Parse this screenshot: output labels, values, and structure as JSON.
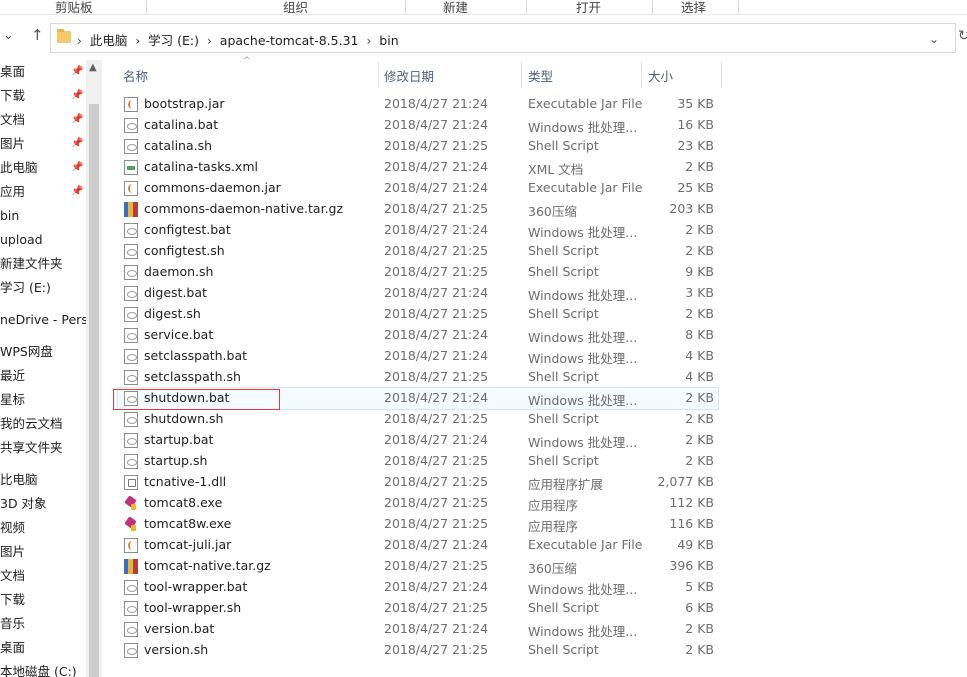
{
  "ribbon": {
    "groups": [
      "剪贴板",
      "组织",
      "新建",
      "打开",
      "选择"
    ]
  },
  "nav_buttons": {
    "dropdown_glyph": "⌄",
    "up_glyph": "↑"
  },
  "address": {
    "breadcrumbs": [
      "此电脑",
      "学习 (E:)",
      "apache-tomcat-8.5.31",
      "bin"
    ],
    "separator": "›",
    "dropdown_glyph": "⌄",
    "refresh_glyph": "↻"
  },
  "sidebar": {
    "items": [
      {
        "label": "桌面",
        "pinned": true
      },
      {
        "label": "下载",
        "pinned": true
      },
      {
        "label": "文档",
        "pinned": true
      },
      {
        "label": "图片",
        "pinned": true
      },
      {
        "label": "此电脑",
        "pinned": true
      },
      {
        "label": "应用",
        "pinned": true
      },
      {
        "label": "bin",
        "pinned": false
      },
      {
        "label": "upload",
        "pinned": false
      },
      {
        "label": "新建文件夹",
        "pinned": false
      },
      {
        "label": "学习 (E:)",
        "pinned": false
      },
      {
        "label": "neDrive - Perso",
        "pinned": false
      },
      {
        "label": "WPS网盘",
        "pinned": false
      },
      {
        "label": "最近",
        "pinned": false
      },
      {
        "label": "星标",
        "pinned": false
      },
      {
        "label": "我的云文档",
        "pinned": false
      },
      {
        "label": "共享文件夹",
        "pinned": false
      },
      {
        "label": "比电脑",
        "pinned": false
      },
      {
        "label": "3D 对象",
        "pinned": false
      },
      {
        "label": "视频",
        "pinned": false
      },
      {
        "label": "图片",
        "pinned": false
      },
      {
        "label": "文档",
        "pinned": false
      },
      {
        "label": "下载",
        "pinned": false
      },
      {
        "label": "音乐",
        "pinned": false
      },
      {
        "label": "桌面",
        "pinned": false
      },
      {
        "label": "本地磁盘 (C:)",
        "pinned": false
      }
    ],
    "pin_glyph": "📌",
    "scroll_up_glyph": "▲"
  },
  "file_list": {
    "sort_glyph": "^",
    "columns": {
      "name": "名称",
      "date": "修改日期",
      "type": "类型",
      "size": "大小"
    },
    "selected_index": 14,
    "rows": [
      {
        "name": "bootstrap.jar",
        "date": "2018/4/27 21:24",
        "type": "Executable Jar File",
        "size": "35 KB",
        "icon": "jar-file-icon"
      },
      {
        "name": "catalina.bat",
        "date": "2018/4/27 21:24",
        "type": "Windows 批处理...",
        "size": "16 KB",
        "icon": "bat-file-icon"
      },
      {
        "name": "catalina.sh",
        "date": "2018/4/27 21:25",
        "type": "Shell Script",
        "size": "23 KB",
        "icon": "sh-file-icon"
      },
      {
        "name": "catalina-tasks.xml",
        "date": "2018/4/27 21:24",
        "type": "XML 文档",
        "size": "2 KB",
        "icon": "xml-file-icon"
      },
      {
        "name": "commons-daemon.jar",
        "date": "2018/4/27 21:24",
        "type": "Executable Jar File",
        "size": "25 KB",
        "icon": "jar-file-icon"
      },
      {
        "name": "commons-daemon-native.tar.gz",
        "date": "2018/4/27 21:25",
        "type": "360压缩",
        "size": "203 KB",
        "icon": "archive-file-icon"
      },
      {
        "name": "configtest.bat",
        "date": "2018/4/27 21:24",
        "type": "Windows 批处理...",
        "size": "2 KB",
        "icon": "bat-file-icon"
      },
      {
        "name": "configtest.sh",
        "date": "2018/4/27 21:25",
        "type": "Shell Script",
        "size": "2 KB",
        "icon": "sh-file-icon"
      },
      {
        "name": "daemon.sh",
        "date": "2018/4/27 21:25",
        "type": "Shell Script",
        "size": "9 KB",
        "icon": "sh-file-icon"
      },
      {
        "name": "digest.bat",
        "date": "2018/4/27 21:24",
        "type": "Windows 批处理...",
        "size": "3 KB",
        "icon": "bat-file-icon"
      },
      {
        "name": "digest.sh",
        "date": "2018/4/27 21:25",
        "type": "Shell Script",
        "size": "2 KB",
        "icon": "sh-file-icon"
      },
      {
        "name": "service.bat",
        "date": "2018/4/27 21:24",
        "type": "Windows 批处理...",
        "size": "8 KB",
        "icon": "bat-file-icon"
      },
      {
        "name": "setclasspath.bat",
        "date": "2018/4/27 21:24",
        "type": "Windows 批处理...",
        "size": "4 KB",
        "icon": "bat-file-icon"
      },
      {
        "name": "setclasspath.sh",
        "date": "2018/4/27 21:25",
        "type": "Shell Script",
        "size": "4 KB",
        "icon": "sh-file-icon"
      },
      {
        "name": "shutdown.bat",
        "date": "2018/4/27 21:24",
        "type": "Windows 批处理...",
        "size": "2 KB",
        "icon": "bat-file-icon"
      },
      {
        "name": "shutdown.sh",
        "date": "2018/4/27 21:25",
        "type": "Shell Script",
        "size": "2 KB",
        "icon": "sh-file-icon"
      },
      {
        "name": "startup.bat",
        "date": "2018/4/27 21:24",
        "type": "Windows 批处理...",
        "size": "2 KB",
        "icon": "bat-file-icon"
      },
      {
        "name": "startup.sh",
        "date": "2018/4/27 21:25",
        "type": "Shell Script",
        "size": "2 KB",
        "icon": "sh-file-icon"
      },
      {
        "name": "tcnative-1.dll",
        "date": "2018/4/27 21:25",
        "type": "应用程序扩展",
        "size": "2,077 KB",
        "icon": "dll-file-icon"
      },
      {
        "name": "tomcat8.exe",
        "date": "2018/4/27 21:25",
        "type": "应用程序",
        "size": "112 KB",
        "icon": "tomcat-exe-icon"
      },
      {
        "name": "tomcat8w.exe",
        "date": "2018/4/27 21:25",
        "type": "应用程序",
        "size": "116 KB",
        "icon": "tomcat-exe-icon"
      },
      {
        "name": "tomcat-juli.jar",
        "date": "2018/4/27 21:24",
        "type": "Executable Jar File",
        "size": "49 KB",
        "icon": "jar-file-icon"
      },
      {
        "name": "tomcat-native.tar.gz",
        "date": "2018/4/27 21:25",
        "type": "360压缩",
        "size": "396 KB",
        "icon": "archive-file-icon"
      },
      {
        "name": "tool-wrapper.bat",
        "date": "2018/4/27 21:24",
        "type": "Windows 批处理...",
        "size": "5 KB",
        "icon": "bat-file-icon"
      },
      {
        "name": "tool-wrapper.sh",
        "date": "2018/4/27 21:25",
        "type": "Shell Script",
        "size": "6 KB",
        "icon": "sh-file-icon"
      },
      {
        "name": "version.bat",
        "date": "2018/4/27 21:24",
        "type": "Windows 批处理...",
        "size": "2 KB",
        "icon": "bat-file-icon"
      },
      {
        "name": "version.sh",
        "date": "2018/4/27 21:25",
        "type": "Shell Script",
        "size": "2 KB",
        "icon": "sh-file-icon"
      }
    ]
  },
  "colors": {
    "accent_highlight": "#e23a3a",
    "selection_border": "#cde8ff",
    "header_text": "#4c607a"
  }
}
